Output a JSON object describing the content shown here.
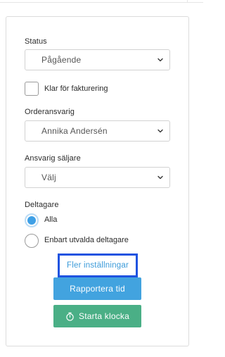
{
  "status": {
    "label": "Status",
    "selected": "Pågående"
  },
  "invoicing": {
    "checkbox_label": "Klar för fakturering",
    "checked": false
  },
  "order_owner": {
    "label": "Orderansvarig",
    "selected": "Annika Andersén"
  },
  "sales_rep": {
    "label": "Ansvarig säljare",
    "selected": "Välj"
  },
  "participants": {
    "label": "Deltagare",
    "options": [
      {
        "label": "Alla",
        "selected": true
      },
      {
        "label": "Enbart utvalda deltagare",
        "selected": false
      }
    ]
  },
  "actions": {
    "more_settings": "Fler inställningar",
    "report_time": "Rapportera tid",
    "start_clock": "Starta klocka"
  },
  "colors": {
    "link": "#3a9ad9",
    "report_button": "#42a3df",
    "clock_button": "#4aaf86",
    "focus_outline": "#1f53e0",
    "radio_selected": "#3fa0e6"
  },
  "icons": {
    "select_chevron": "chevron-down-icon",
    "clock": "stopwatch-icon"
  }
}
